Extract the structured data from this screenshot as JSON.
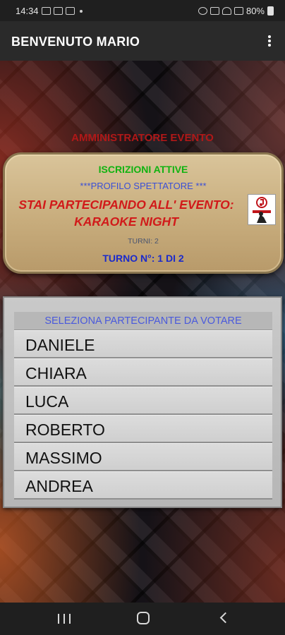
{
  "status_bar": {
    "time": "14:34",
    "battery": "80%"
  },
  "app_bar": {
    "title": "BENVENUTO MARIO"
  },
  "admin_label": "AMMINISTRATORE EVENTO",
  "event": {
    "status": "ISCRIZIONI ATTIVE",
    "profile": "***PROFILO SPETTATORE ***",
    "line1": "STAI PARTECIPANDO ALL' EVENTO:",
    "line2": "KARAOKE NIGHT",
    "turns": "TURNI: 2",
    "turn_no": "TURNO N°:  1 DI 2",
    "logo_icon": "music-note-logo-icon"
  },
  "vote": {
    "header": "SELEZIONA PARTECIPANTE DA VOTARE",
    "participants": [
      "DANIELE",
      "CHIARA",
      "LUCA",
      "ROBERTO",
      "MASSIMO",
      "ANDREA"
    ]
  },
  "colors": {
    "admin_red": "#b01818",
    "active_green": "#10b310",
    "profile_blue": "#3a4fd6",
    "event_red": "#d11a1a",
    "turn_blue": "#1a2acc",
    "card_tan": "#c8ad7d"
  }
}
